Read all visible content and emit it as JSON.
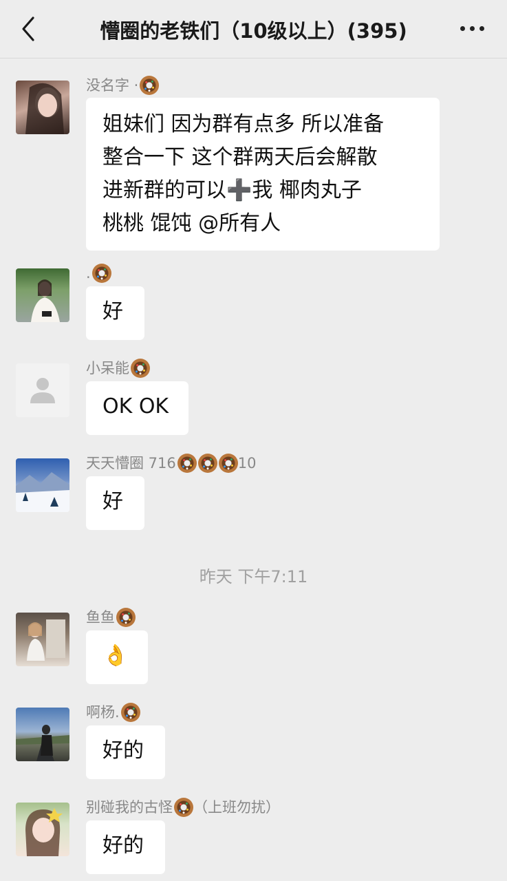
{
  "header": {
    "title": "懵圈的老铁们（10级以上）(395)"
  },
  "messages": [
    {
      "sender": "没名字 ·",
      "lines": [
        "姐妹们 因为群有点多 所以准备",
        "整合一下  这个群两天后会解散",
        "进新群的可以➕我  椰肉丸子",
        "桃桃 馄饨 @所有人"
      ],
      "avatar_colors": [
        "#3b2a25",
        "#c9a89b"
      ]
    },
    {
      "sender": ".",
      "text": "好",
      "avatar_colors": [
        "#4d7a3d",
        "#e8e2da"
      ]
    },
    {
      "sender": "小呆能",
      "text": "OK OK",
      "avatar_colors": [
        "#f1f1f1",
        "#c8c8c8"
      ]
    },
    {
      "sender": "天天懵圈 716",
      "sender_suffix": "10",
      "text": "好",
      "avatar_colors": [
        "#6e8fc6",
        "#e9eef7"
      ]
    },
    {
      "sender": "鱼鱼",
      "text": "👌",
      "avatar_colors": [
        "#8c7b6b",
        "#e6ddd4"
      ]
    },
    {
      "sender": "啊杨.",
      "text": "好的",
      "avatar_colors": [
        "#6b8bb5",
        "#2a2a2a"
      ]
    },
    {
      "sender": "别碰我的古怪",
      "sender_suffix": "（上班勿扰）",
      "text": "好的",
      "avatar_colors": [
        "#c7d8b5",
        "#f3e4da"
      ]
    }
  ],
  "timestamp": "昨天 下午7:11",
  "colors": {
    "background": "#ededed",
    "bubble": "#ffffff",
    "name": "#888888"
  }
}
